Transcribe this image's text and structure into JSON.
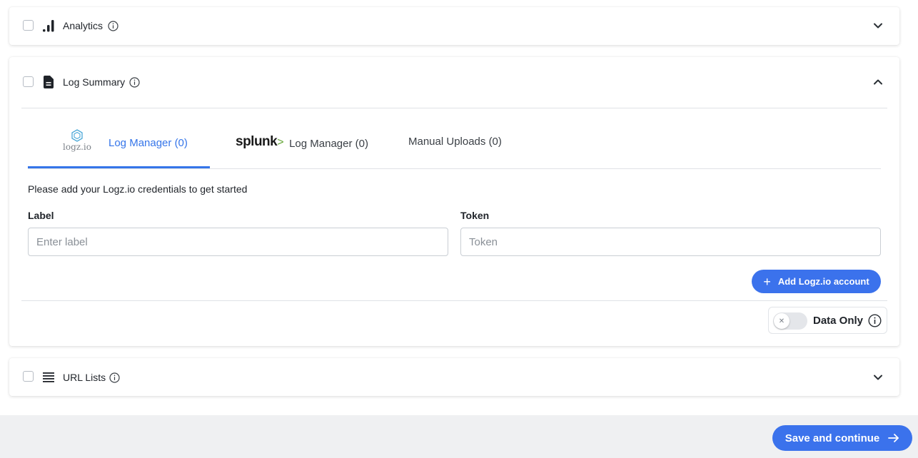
{
  "sections": {
    "analytics": {
      "title": "Analytics",
      "icon": "bar-chart-icon",
      "expanded": false
    },
    "log_summary": {
      "title": "Log Summary",
      "icon": "document-icon",
      "expanded": true
    },
    "url_lists": {
      "title": "URL Lists",
      "icon": "list-icon",
      "expanded": false
    }
  },
  "tabs": [
    {
      "logo": "logz.io",
      "label": "Log Manager (0)",
      "active": true
    },
    {
      "logo": "splunk>",
      "label": "Log Manager (0)",
      "active": false
    },
    {
      "label": "Manual Uploads (0)",
      "active": false
    }
  ],
  "form": {
    "intro": "Please add your Logz.io credentials to get started",
    "label_field": {
      "label": "Label",
      "placeholder": "Enter label",
      "value": ""
    },
    "token_field": {
      "label": "Token",
      "placeholder": "Token",
      "value": ""
    },
    "add_button": "Add Logz.io account"
  },
  "toggle": {
    "label": "Data Only",
    "on": false
  },
  "footer": {
    "save_button": "Save and continue"
  },
  "colors": {
    "accent": "#3b72ec",
    "active_tab": "#3575e9",
    "splunk_green": "#65a637",
    "footer_bg": "#eff0f2"
  }
}
